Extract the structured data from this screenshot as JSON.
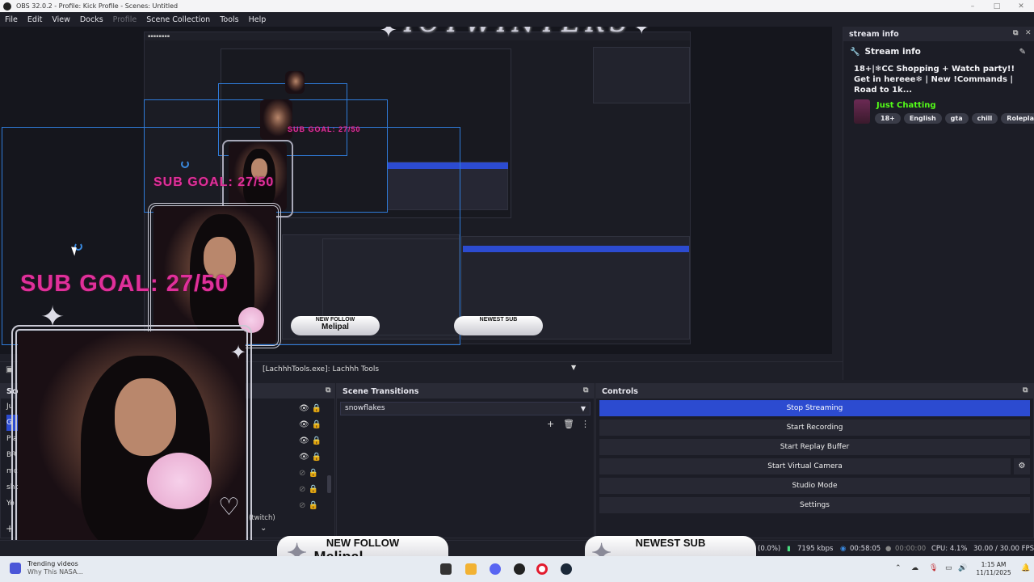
{
  "window": {
    "title": "OBS 32.0.2 - Profile: Kick Profile - Scenes: Untitled",
    "controls": [
      "–",
      "□",
      "✕"
    ]
  },
  "menu": [
    "File",
    "Edit",
    "View",
    "Docks",
    "Profile",
    "Scene Collection",
    "Tools",
    "Help"
  ],
  "overlay": {
    "sub_goal": "SUB GOAL: 27/50",
    "new_follow_label": "NEW FOLLOW",
    "new_follow_name": "Melipal",
    "newest_sub_label": "NEWEST SUB",
    "watermark": "ICYWINTERS"
  },
  "stream_info": {
    "dock_title": "stream info",
    "heading": "Stream info",
    "description": "18+|❄CC Shopping + Watch party!! Get in hereee❄ | New !Commands | Road to 1k...",
    "category": "Just Chatting",
    "tags": [
      "18+",
      "English",
      "gta",
      "chill",
      "Roleplay"
    ]
  },
  "source_toolbar": {
    "selected": "[LachhhTools.exe]: Lachhh Tools"
  },
  "scenes": {
    "header": "Scenes",
    "items": [
      "Ju",
      "G",
      "Pla",
      "BR",
      "mc",
      "sho",
      "Yo"
    ]
  },
  "sources": {
    "partial_label": "(twitch)"
  },
  "scene_transitions": {
    "header": "Scene Transitions",
    "selected": "snowflakes"
  },
  "controls": {
    "header": "Controls",
    "buttons": [
      "Stop Streaming",
      "Start Recording",
      "Start Replay Buffer",
      "Start Virtual Camera",
      "Studio Mode",
      "Settings"
    ]
  },
  "status": {
    "dropped": "(0.0%)",
    "bitrate": "7195 kbps",
    "stream_time": "00:58:05",
    "rec_time": "00:00:00",
    "cpu": "CPU: 4.1%",
    "fps": "30.00 / 30.00 FPS"
  },
  "taskbar": {
    "news_title": "Trending videos",
    "news_sub": "Why This NASA...",
    "time": "1:15 AM",
    "date": "11/11/2025"
  },
  "colors": {
    "accent_blue": "#2c4bd0",
    "kick_green": "#53fc18",
    "overlay_pink": "#e0309a"
  }
}
